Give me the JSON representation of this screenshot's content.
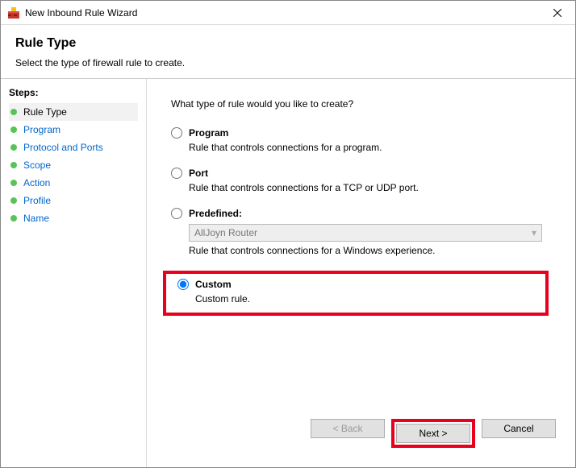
{
  "titlebar": {
    "title": "New Inbound Rule Wizard"
  },
  "header": {
    "title": "Rule Type",
    "subtitle": "Select the type of firewall rule to create."
  },
  "sidebar": {
    "heading": "Steps:",
    "items": [
      {
        "label": "Rule Type",
        "current": true
      },
      {
        "label": "Program"
      },
      {
        "label": "Protocol and Ports"
      },
      {
        "label": "Scope"
      },
      {
        "label": "Action"
      },
      {
        "label": "Profile"
      },
      {
        "label": "Name"
      }
    ]
  },
  "main": {
    "prompt": "What type of rule would you like to create?",
    "options": {
      "program": {
        "label": "Program",
        "desc": "Rule that controls connections for a program."
      },
      "port": {
        "label": "Port",
        "desc": "Rule that controls connections for a TCP or UDP port."
      },
      "predefined": {
        "label": "Predefined:",
        "selected": "AllJoyn Router",
        "desc": "Rule that controls connections for a Windows experience."
      },
      "custom": {
        "label": "Custom",
        "desc": "Custom rule."
      }
    }
  },
  "footer": {
    "back": "< Back",
    "next": "Next >",
    "cancel": "Cancel"
  }
}
